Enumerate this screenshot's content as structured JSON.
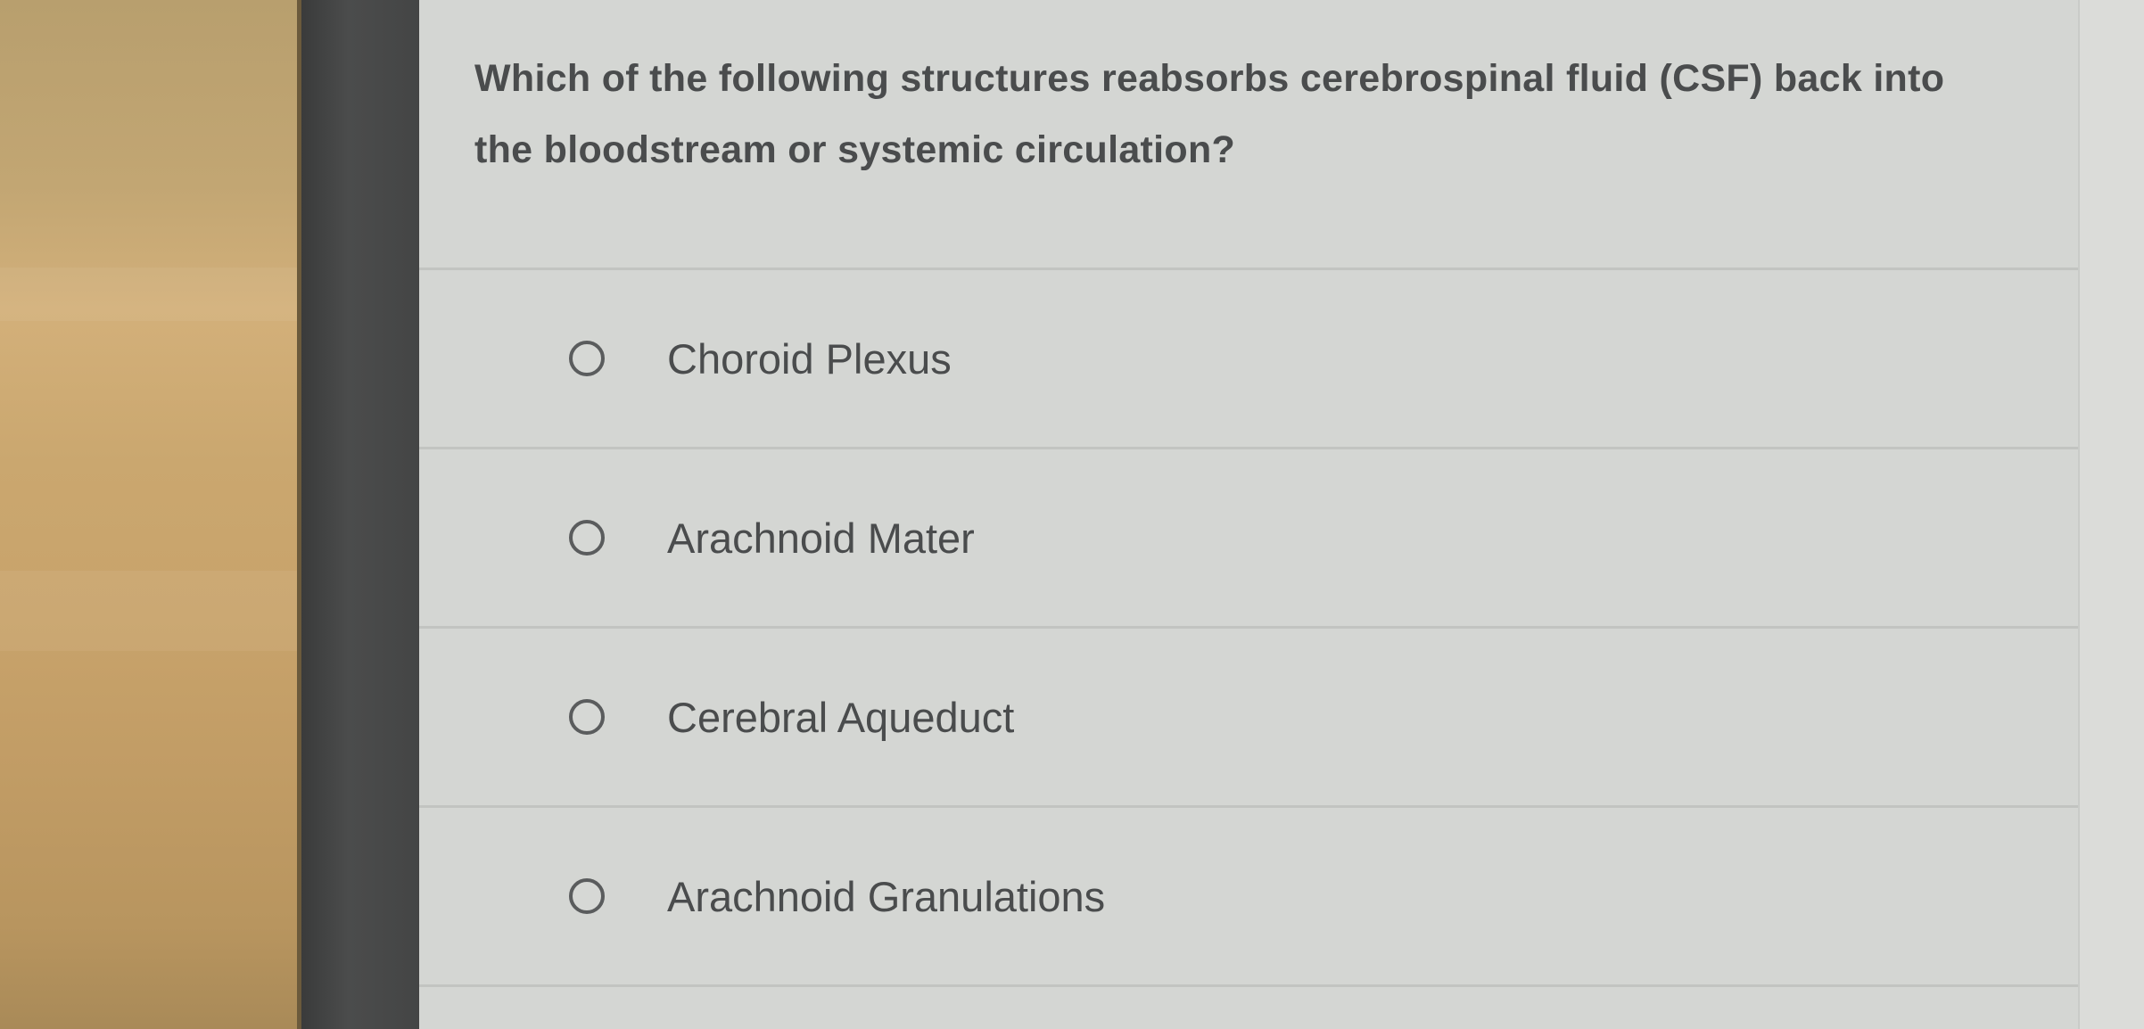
{
  "question": {
    "text": "Which of the following structures reabsorbs cerebrospinal fluid (CSF) back into the bloodstream or systemic circulation?"
  },
  "options": [
    {
      "label": "Choroid Plexus",
      "selected": false
    },
    {
      "label": "Arachnoid Mater",
      "selected": false
    },
    {
      "label": "Cerebral Aqueduct",
      "selected": false
    },
    {
      "label": "Arachnoid Granulations",
      "selected": false
    }
  ],
  "colors": {
    "text": "#4a4c4d",
    "card_background": "#d4d6d3",
    "divider": "#c2c4c1",
    "bezel": "#444545"
  }
}
